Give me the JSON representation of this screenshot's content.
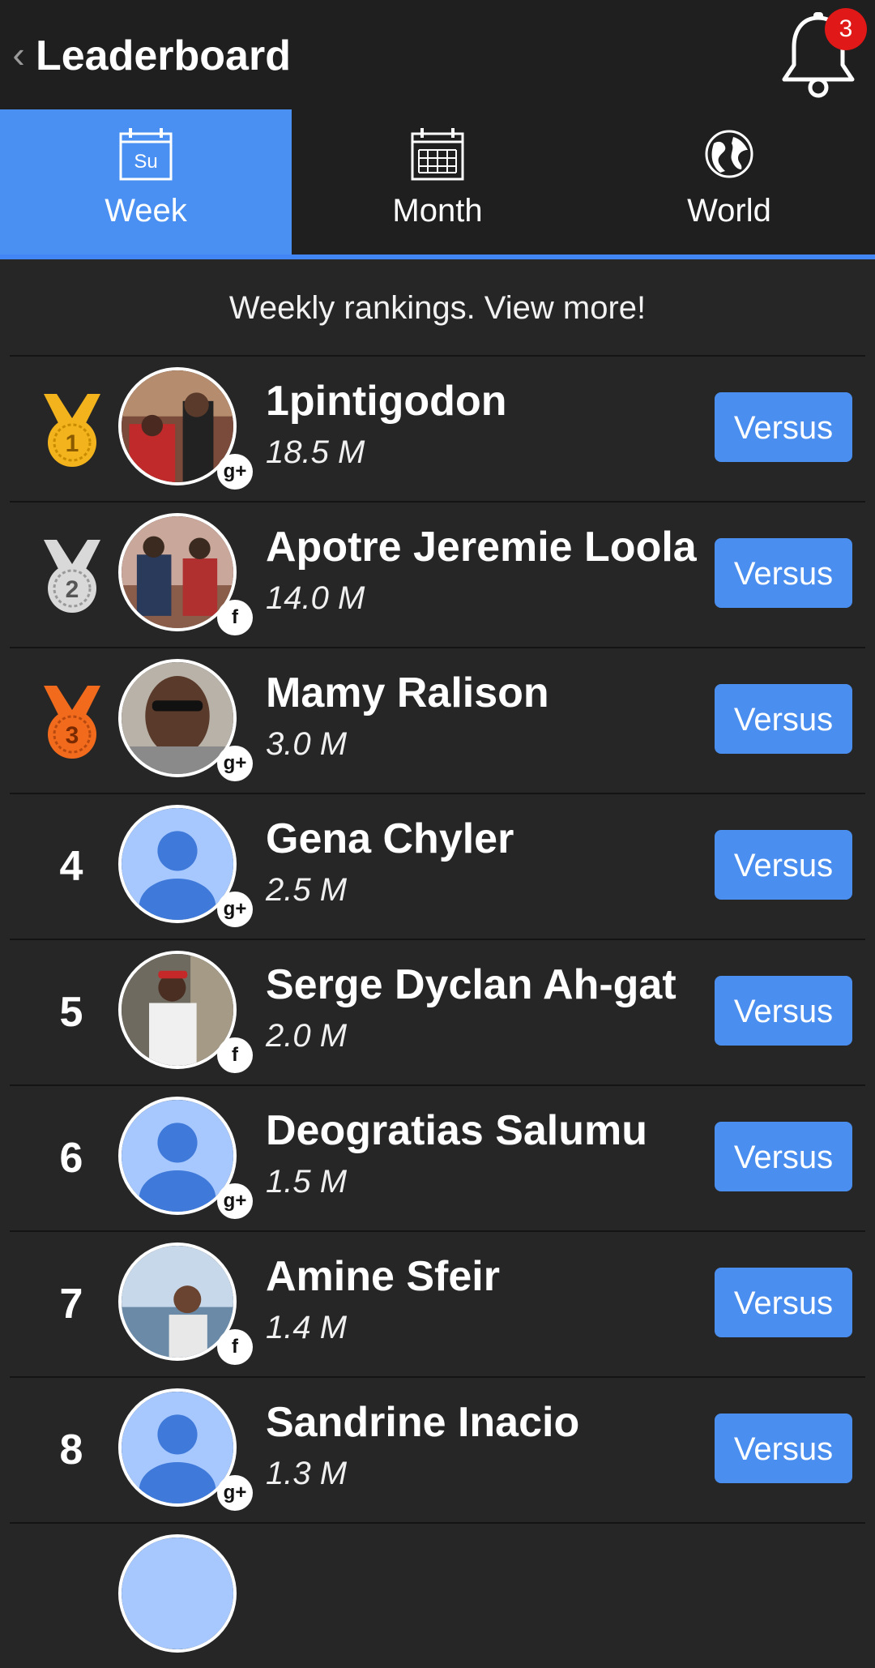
{
  "header": {
    "title": "Leaderboard",
    "notification_count": "3"
  },
  "tabs": [
    {
      "label": "Week",
      "icon_text": "Su",
      "icon": "calendar-day-icon",
      "active": true
    },
    {
      "label": "Month",
      "icon": "calendar-grid-icon",
      "active": false
    },
    {
      "label": "World",
      "icon": "globe-icon",
      "active": false
    }
  ],
  "subtitle": "Weekly rankings. View more!",
  "leaderboard": [
    {
      "rank": "1",
      "medal": "gold",
      "name": "1pintigodon",
      "score": "18.5 M",
      "social": "g+",
      "versus": "Versus"
    },
    {
      "rank": "2",
      "medal": "silver",
      "name": "Apotre Jeremie Loola",
      "score": "14.0 M",
      "social": "f",
      "versus": "Versus"
    },
    {
      "rank": "3",
      "medal": "bronze",
      "name": "Mamy Ralison",
      "score": "3.0 M",
      "social": "g+",
      "versus": "Versus"
    },
    {
      "rank": "4",
      "name": "Gena Chyler",
      "score": "2.5 M",
      "social": "g+",
      "versus": "Versus"
    },
    {
      "rank": "5",
      "name": "Serge Dyclan Ah-gat",
      "score": "2.0 M",
      "social": "f",
      "versus": "Versus"
    },
    {
      "rank": "6",
      "name": "Deogratias Salumu",
      "score": "1.5 M",
      "social": "g+",
      "versus": "Versus"
    },
    {
      "rank": "7",
      "name": "Amine Sfeir",
      "score": "1.4 M",
      "social": "f",
      "versus": "Versus"
    },
    {
      "rank": "8",
      "name": "Sandrine Inacio",
      "score": "1.3 M",
      "social": "g+",
      "versus": "Versus"
    }
  ],
  "colors": {
    "accent": "#4a8ef0",
    "gold": "#f2b31c",
    "silver": "#d9d9d9",
    "bronze": "#f26b1d",
    "badge_red": "#e01818"
  }
}
